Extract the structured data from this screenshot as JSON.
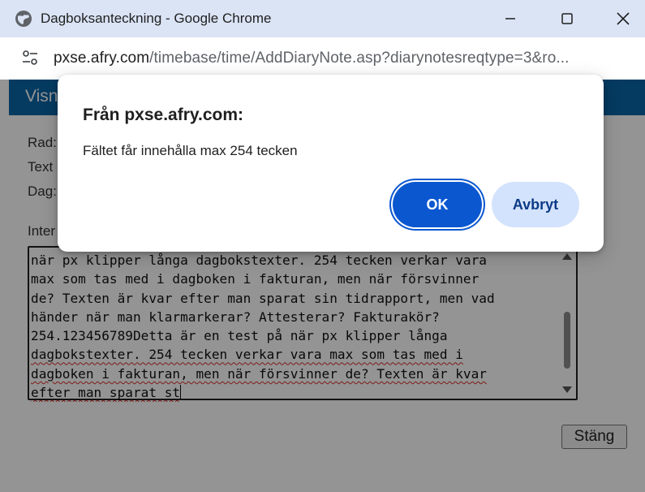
{
  "window": {
    "title": "Dagboksanteckning - Google Chrome",
    "url_host": "pxse.afry.com",
    "url_path": "/timebase/time/AddDiaryNote.asp?diarynotesreqtype=3&ro..."
  },
  "page": {
    "banner_text": "Visn",
    "labels": {
      "rad": "Rad:",
      "text": "Text",
      "dag": "Dag:",
      "intern": "Inter"
    },
    "textarea_lines": [
      [
        {
          "t": "när px klipper långa dagbokstexter. 254 tecken verkar vara",
          "sq": false
        }
      ],
      [
        {
          "t": "max som tas med i dagboken i fakturan, men när försvinner",
          "sq": false
        }
      ],
      [
        {
          "t": "de? Texten är kvar efter man sparat sin tidrapport, men vad",
          "sq": false
        }
      ],
      [
        {
          "t": "händer när man klarmarkerar? Attesterar? Fakturakör?",
          "sq": false
        }
      ],
      [
        {
          "t": "254.123456789Detta är en test på när px klipper långa",
          "sq": false
        }
      ],
      [
        {
          "t": "dagbokstexter. 254 tecken verkar vara max som tas med i",
          "sq": true
        }
      ],
      [
        {
          "t": "dagboken i fakturan, men när försvinner de? Texten är kvar",
          "sq": true
        }
      ],
      [
        {
          "t": "efter man sparat st",
          "sq": true
        }
      ]
    ],
    "close_label": "Stäng"
  },
  "dialog": {
    "title": "Från pxse.afry.com:",
    "message": "Fältet får innehålla max 254 tecken",
    "ok_label": "OK",
    "cancel_label": "Avbryt"
  },
  "colors": {
    "titlebar": "#dbe4f5",
    "banner": "#0a67a8",
    "primary_button": "#0b57d0",
    "secondary_button": "#d3e3fd",
    "spellcheck": "#d93025"
  },
  "icons": {
    "title_icon": "globe-icon",
    "address_icon": "site-settings-icon"
  }
}
